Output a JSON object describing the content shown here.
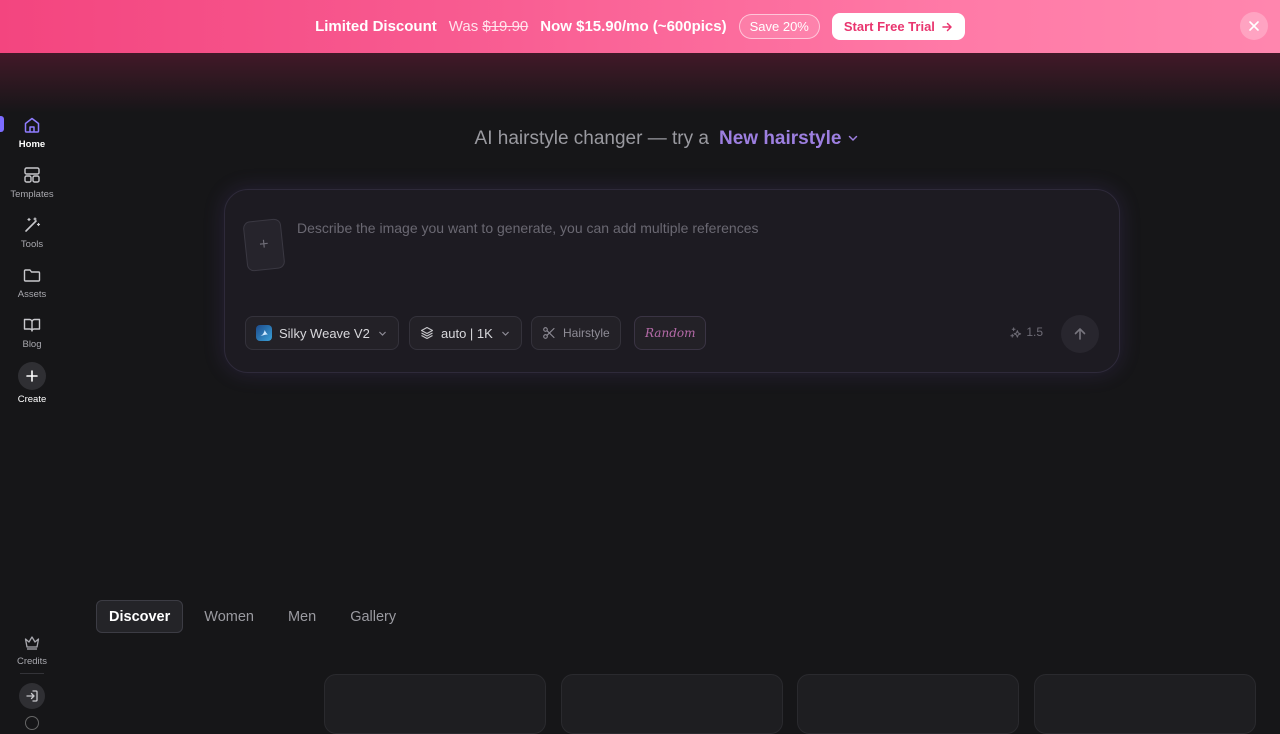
{
  "banner": {
    "title": "Limited Discount",
    "was_label": "Was",
    "old_price": "$19.90",
    "new_price": "Now $15.90/mo (~600pics)",
    "save_badge": "Save 20%",
    "trial_button": "Start Free Trial",
    "gradient_start": "#f3457f",
    "gradient_end": "#ff86ae"
  },
  "sidebar": {
    "items": [
      {
        "label": "Home",
        "icon": "home-icon",
        "active": true
      },
      {
        "label": "Templates",
        "icon": "templates-icon",
        "active": false
      },
      {
        "label": "Tools",
        "icon": "magic-wand-icon",
        "active": false
      },
      {
        "label": "Assets",
        "icon": "folder-icon",
        "active": false
      },
      {
        "label": "Blog",
        "icon": "book-icon",
        "active": false
      },
      {
        "label": "Create",
        "icon": "plus-icon",
        "active": false
      }
    ],
    "credits_label": "Credits",
    "accent": "#7c6cff"
  },
  "hero": {
    "prefix": "AI hairstyle changer — try a",
    "accent_text": "New hairstyle",
    "accent_color": "#9d7fe0"
  },
  "prompt": {
    "placeholder": "Describe the image you want to generate, you can add multiple references",
    "add_reference_symbol": "+",
    "model": "Silky Weave V2",
    "ratio": "auto | 1K",
    "style_chip": "Hairstyle",
    "random_chip": "Random",
    "cost": "1.5"
  },
  "tabs": [
    {
      "label": "Discover",
      "active": true
    },
    {
      "label": "Women",
      "active": false
    },
    {
      "label": "Men",
      "active": false
    },
    {
      "label": "Gallery",
      "active": false
    }
  ]
}
